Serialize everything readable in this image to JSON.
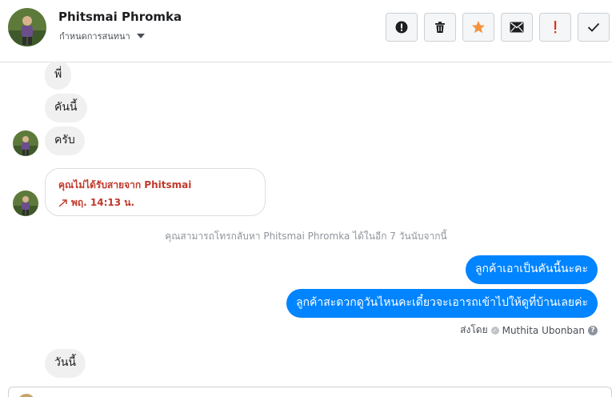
{
  "header": {
    "contact_name": "Phitsmai Phromka",
    "subtitle": "กำหนดการสนทนา",
    "toolbar": [
      {
        "icon": "alert-circle-icon",
        "color": "#1c1e21"
      },
      {
        "icon": "trash-icon",
        "color": "#1c1e21"
      },
      {
        "icon": "star-icon",
        "color": "#f7923b"
      },
      {
        "icon": "envelope-icon",
        "color": "#1c1e21"
      },
      {
        "icon": "exclamation-icon",
        "color": "#e0301e"
      },
      {
        "icon": "check-icon",
        "color": "#1c1e21"
      }
    ]
  },
  "messages": {
    "m1": "พี่",
    "m2": "คันนี้",
    "m3": "ครับ",
    "call_title": "คุณไม่ได้รับสายจาก Phitsmai",
    "call_time": "พฤ. 14:13 น.",
    "notice": "คุณสามารถโทรกลับหา Phitsmai Phromka ได้ในอีก 7 วันนับจากนี้",
    "out1": "ลูกค้าเอาเป็นคันนี้นะคะ",
    "out2": "ลูกค้าสะดวกดูวันไหนคะเดี๋ยวจะเอารถเข้าไปให้ดูที่บ้านเลยค่ะ",
    "sent_by_prefix": "ส่งโดย",
    "sent_by_name": "Muthita Ubonban",
    "m4": "วันนี้"
  },
  "colors": {
    "accent": "#0084ff",
    "incoming_bubble": "#f1f0f0",
    "missed_call": "#c0392b"
  }
}
